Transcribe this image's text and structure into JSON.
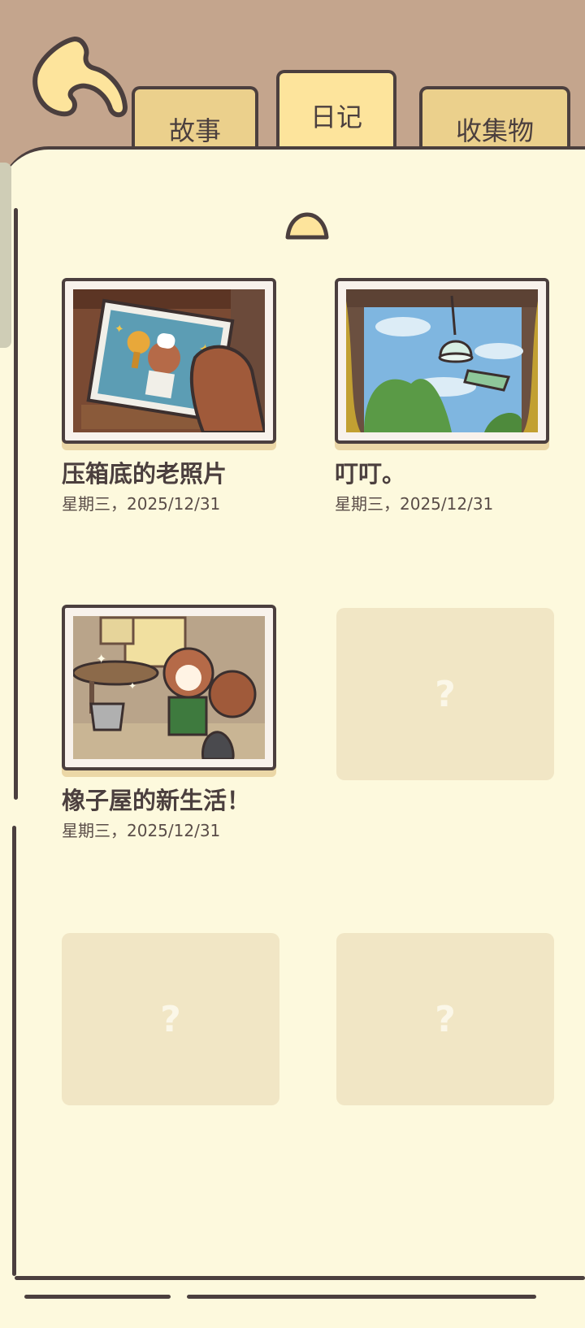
{
  "nav": {
    "back_icon": "back-arrow-icon"
  },
  "tabs": [
    {
      "label": "故事",
      "active": false
    },
    {
      "label": "日记",
      "active": true
    },
    {
      "label": "收集物",
      "active": false
    }
  ],
  "diary": {
    "entries": [
      {
        "title": "压箱底的老照片",
        "date": "星期三，2025/12/31",
        "image": "old-photo-image"
      },
      {
        "title": "叮叮。",
        "date": "星期三，2025/12/31",
        "image": "wind-chime-image"
      },
      {
        "title": "橡子屋的新生活！",
        "date": "星期三，2025/12/31",
        "image": "new-life-image"
      }
    ],
    "locked_slots": [
      {
        "label": "?"
      },
      {
        "label": "?"
      },
      {
        "label": "?"
      }
    ]
  },
  "colors": {
    "header_bg": "#c4a58d",
    "page_bg": "#fdf9dd",
    "tab_active": "#fde49c",
    "tab_inactive": "#ebd08c",
    "outline": "#4b3f3e",
    "locked_bg": "#f1e6c5"
  }
}
